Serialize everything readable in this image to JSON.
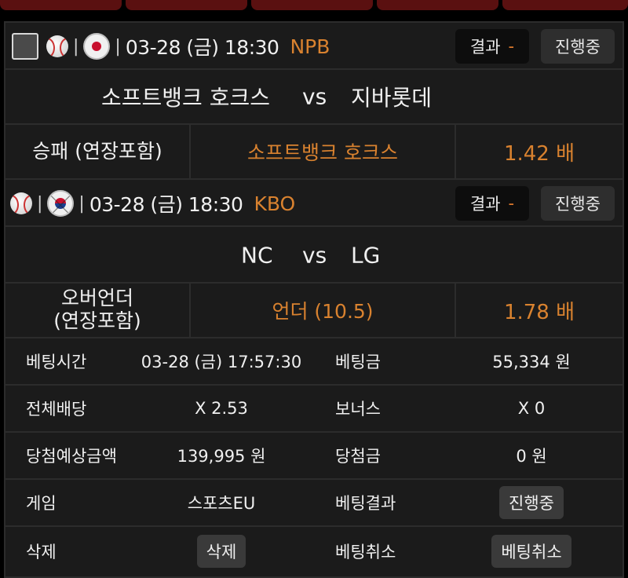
{
  "matches": [
    {
      "has_checkbox": true,
      "flag": "japan-flag-icon",
      "sport_icon": "baseball-icon",
      "date": "03-28 (금) 18:30",
      "league": "NPB",
      "result_label": "결과",
      "result_value": "-",
      "status": "진행중",
      "home": "소프트뱅크 호크스",
      "vs": "vs",
      "away": "지바롯데",
      "bet_type": "승패 (연장포함)",
      "pick": "소프트뱅크 호크스",
      "odds": "1.42 배"
    },
    {
      "has_checkbox": false,
      "flag": "korea-flag-icon",
      "sport_icon": "baseball-icon",
      "date": "03-28 (금) 18:30",
      "league": "KBO",
      "result_label": "결과",
      "result_value": "-",
      "status": "진행중",
      "home": "NC",
      "vs": "vs",
      "away": "LG",
      "bet_type_line1": "오버언더",
      "bet_type_line2": "(연장포함)",
      "pick": "언더 (10.5)",
      "odds": "1.78 배"
    }
  ],
  "summary": {
    "bet_time_label": "베팅시간",
    "bet_time": "03-28 (금) 17:57:30",
    "bet_amount_label": "베팅금",
    "bet_amount": "55,334 원",
    "total_odds_label": "전체배당",
    "total_odds": "X 2.53",
    "bonus_label": "보너스",
    "bonus": "X 0",
    "expected_win_label": "당첨예상금액",
    "expected_win": "139,995 원",
    "win_amount_label": "당첨금",
    "win_amount": "0 원",
    "game_label": "게임",
    "game": "스포츠EU",
    "bet_result_label": "베팅결과",
    "bet_result": "진행중",
    "delete_label": "삭제",
    "delete_button": "삭제",
    "cancel_label": "베팅취소",
    "cancel_button": "베팅취소"
  },
  "colors": {
    "accent": "#d9822f",
    "background": "#1b1b1b",
    "border": "#2c2c2c",
    "top_tab": "#5a1010"
  }
}
